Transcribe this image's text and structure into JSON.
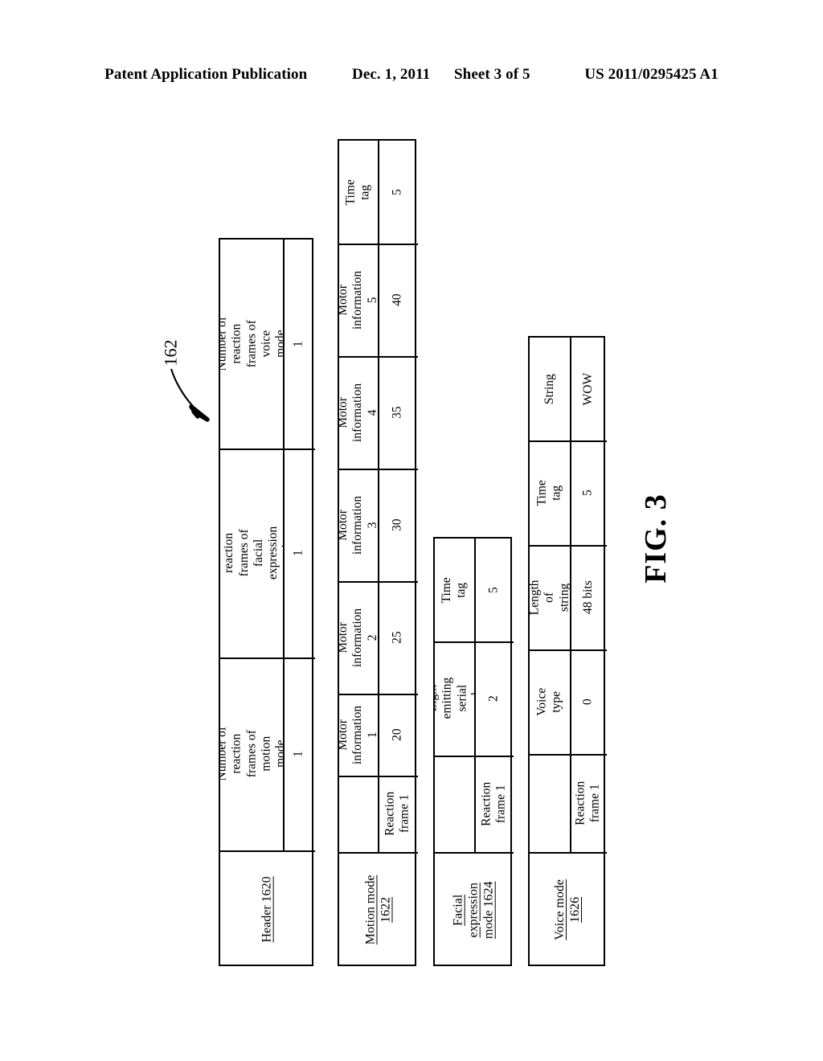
{
  "publication_header": {
    "left": "Patent Application Publication",
    "date": "Dec. 1, 2011",
    "sheet": "Sheet 3 of 5",
    "patent_number": "US 2011/0295425 A1"
  },
  "figure": {
    "caption": "FIG. 3",
    "reference_numeral": "162"
  },
  "tables": {
    "header": {
      "row_label": "Header 1620",
      "columns": [
        {
          "head": "Number of reaction\nframes of motion\nmode",
          "value": "1"
        },
        {
          "head": "Number of reaction\nframes of facial\nexpression mode",
          "value": "1"
        },
        {
          "head": "Number of reaction\nframes of voice\nmode",
          "value": "1"
        }
      ]
    },
    "motion_mode": {
      "row_label": "Motion mode\n1622",
      "frame_label": "Reaction\nframe 1",
      "columns": [
        {
          "head": "Motor\ninformation 1",
          "value": "20"
        },
        {
          "head": "Motor\ninformation 2",
          "value": "25"
        },
        {
          "head": "Motor\ninformation 3",
          "value": "30"
        },
        {
          "head": "Motor\ninformation 4",
          "value": "35"
        },
        {
          "head": "Motor\ninformation 5",
          "value": "40"
        },
        {
          "head": "Time tag",
          "value": "5"
        }
      ]
    },
    "facial_expression_mode": {
      "row_label": "Facial expression\nmode 1624",
      "frame_label": "Reaction\nframe 1",
      "columns": [
        {
          "head": "Light emitting\nserial number",
          "value": "2"
        },
        {
          "head": "Time tag",
          "value": "5"
        }
      ]
    },
    "voice_mode": {
      "row_label": "Voice mode\n1626",
      "frame_label": "Reaction\nframe 1",
      "columns": [
        {
          "head": "Voice type",
          "value": "0"
        },
        {
          "head": "Length of\nstring",
          "value": "48 bits"
        },
        {
          "head": "Time tag",
          "value": "5"
        },
        {
          "head": "String",
          "value": "WOW"
        }
      ]
    }
  }
}
